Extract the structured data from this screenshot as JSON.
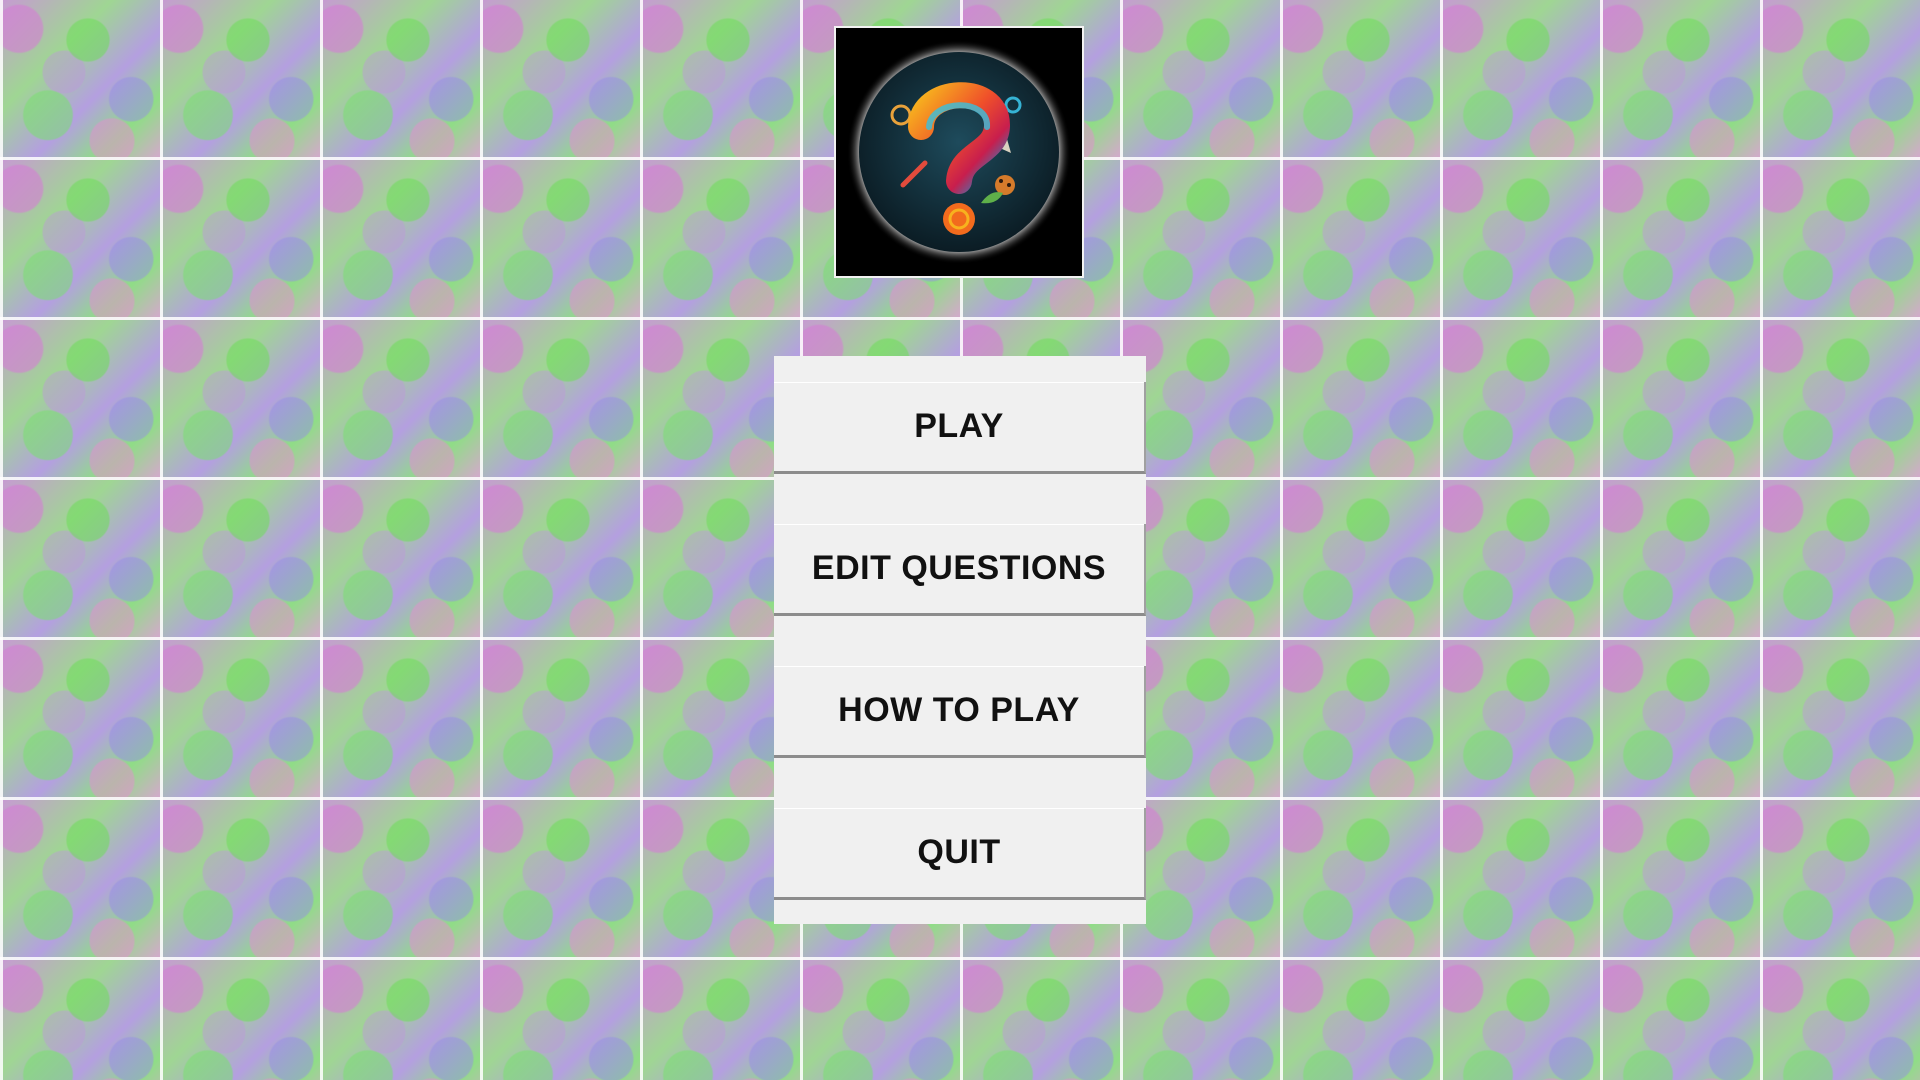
{
  "background": {
    "pattern": "tiled-pastel-mosaic",
    "colors": [
      "#c79ad3",
      "#9fd693",
      "#b49fe0",
      "#8fdd86"
    ]
  },
  "logo": {
    "icon": "question-mark-icon",
    "colors": {
      "frame": "#000000",
      "disc": "#0f2a36",
      "accent_orange": "#f26b1d",
      "accent_red": "#d9262b",
      "accent_blue": "#1a8fd1"
    }
  },
  "menu": {
    "play_label": "PLAY",
    "edit_questions_label": "EDIT QUESTIONS",
    "how_to_play_label": "HOW TO PLAY",
    "quit_label": "QUIT"
  }
}
